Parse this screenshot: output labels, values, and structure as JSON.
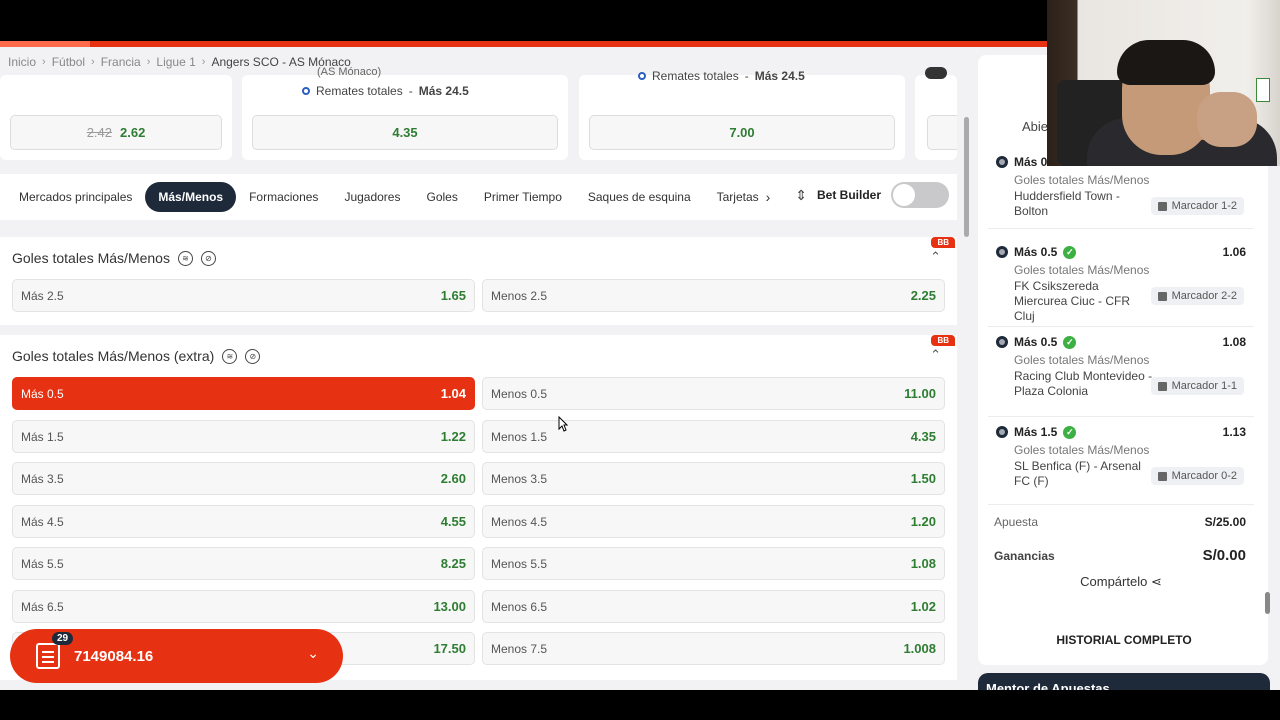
{
  "breadcrumb": [
    "Inicio",
    "Fútbol",
    "Francia",
    "Ligue 1",
    "Angers SCO - AS Mónaco"
  ],
  "top_cards": {
    "card1": {
      "old_odd": "2.42",
      "odd": "2.62"
    },
    "card2": {
      "partial_text": "(AS Mónaco)",
      "note_label": "Remates totales",
      "note_value": "Más 24.5",
      "odd": "4.35"
    },
    "card3": {
      "note_label": "Remates totales",
      "note_value": "Más 24.5",
      "odd": "7.00"
    }
  },
  "tabs": [
    "Mercados principales",
    "Más/Menos",
    "Formaciones",
    "Jugadores",
    "Goles",
    "Primer Tiempo",
    "Saques de esquina",
    "Tarjetas"
  ],
  "active_tab": "Más/Menos",
  "bet_builder_label": "Bet Builder",
  "bb_badge": "BB",
  "market1": {
    "title": "Goles totales Más/Menos",
    "selections": [
      {
        "label": "Más 2.5",
        "odd": "1.65"
      },
      {
        "label": "Menos 2.5",
        "odd": "2.25"
      }
    ]
  },
  "market2": {
    "title": "Goles totales Más/Menos (extra)",
    "rows": [
      {
        "over": "Más 0.5",
        "over_odd": "1.04",
        "under": "Menos 0.5",
        "under_odd": "11.00"
      },
      {
        "over": "Más 1.5",
        "over_odd": "1.22",
        "under": "Menos 1.5",
        "under_odd": "4.35"
      },
      {
        "over": "Más 3.5",
        "over_odd": "2.60",
        "under": "Menos 3.5",
        "under_odd": "1.50"
      },
      {
        "over": "Más 4.5",
        "over_odd": "4.55",
        "under": "Menos 4.5",
        "under_odd": "1.20"
      },
      {
        "over": "Más 5.5",
        "over_odd": "8.25",
        "under": "Menos 5.5",
        "under_odd": "1.08"
      },
      {
        "over": "Más 6.5",
        "over_odd": "13.00",
        "under": "Menos 6.5",
        "under_odd": "1.02"
      },
      {
        "over": "",
        "over_odd": "17.50",
        "under": "Menos 7.5",
        "under_odd": "1.008"
      }
    ]
  },
  "slip": {
    "count": "29",
    "amount": "7149084.16"
  },
  "right_panel": {
    "tab_partial": "Abie",
    "legs": [
      {
        "pick": "Más 0.5",
        "odd": "",
        "market": "Goles totales Más/Menos",
        "match": "Huddersfield Town - Bolton",
        "score": "Marcador 1-2"
      },
      {
        "pick": "Más 0.5",
        "odd": "1.06",
        "market": "Goles totales Más/Menos",
        "match": "FK Csikszereda Miercurea Ciuc - CFR Cluj",
        "score": "Marcador 2-2"
      },
      {
        "pick": "Más 0.5",
        "odd": "1.08",
        "market": "Goles totales Más/Menos",
        "match": "Racing Club Montevideo - Plaza Colonia",
        "score": "Marcador 1-1"
      },
      {
        "pick": "Más 1.5",
        "odd": "1.13",
        "market": "Goles totales Más/Menos",
        "match": "SL Benfica (F) - Arsenal FC (F)",
        "score": "Marcador 0-2"
      }
    ],
    "stake_label": "Apuesta",
    "stake_value": "S/25.00",
    "win_label": "Ganancias",
    "win_value": "S/0.00",
    "share_label": "Compártelo",
    "history_label": "HISTORIAL COMPLETO",
    "mentor_label": "Mentor de Apuestas"
  },
  "colors": {
    "accent": "#e63212",
    "odd_green": "#2e7d32",
    "dark": "#1e2a3a"
  }
}
